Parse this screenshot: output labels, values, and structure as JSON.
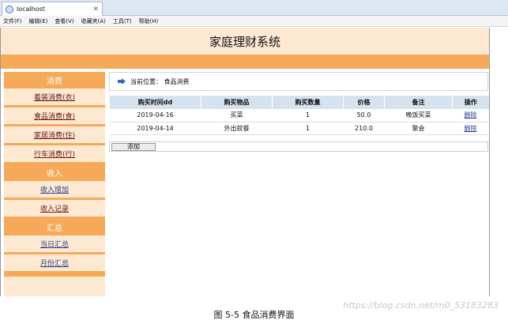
{
  "browser": {
    "tab_label": "localhost",
    "menu": [
      "文件(F)",
      "编辑(E)",
      "查看(V)",
      "收藏夹(A)",
      "工具(T)",
      "帮助(H)"
    ]
  },
  "app": {
    "title": "家庭理财系统"
  },
  "sidebar": {
    "sections": [
      {
        "title": "消费",
        "items": [
          "着装消费(衣)",
          "食品消费(食)",
          "家居消费(住)",
          "行车消费(行)"
        ]
      },
      {
        "title": "收入",
        "items": [
          "收入增加",
          "收入记录"
        ]
      },
      {
        "title": "汇总",
        "items": [
          "当日汇总",
          "月份汇总"
        ]
      }
    ]
  },
  "content": {
    "breadcrumb": "当前位置： 食品消费",
    "table": {
      "headers": [
        "购买时间dd",
        "购买物品",
        "购买数量",
        "价格",
        "备注",
        "操作"
      ],
      "rows": [
        [
          "2019-04-16",
          "买菜",
          "1",
          "50.0",
          "晚饭买菜",
          "删除"
        ],
        [
          "2019-04-14",
          "外出就餐",
          "1",
          "210.0",
          "聚会",
          "删除"
        ]
      ]
    },
    "add_button": "添加"
  },
  "caption": "图 5-5  食品消费界面",
  "watermark": "https://blog.csdn.net/m0_53183283"
}
